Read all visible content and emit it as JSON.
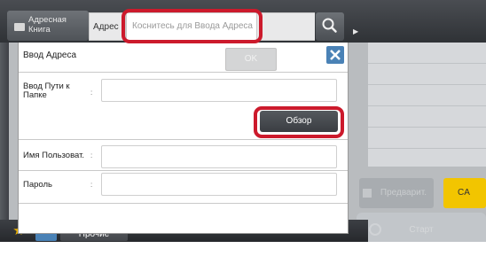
{
  "header": {
    "address_book_label": "Адресная Книга",
    "address_label": "Адрес",
    "address_placeholder": "Коснитесь для Ввода Адреса",
    "search_icon": "search-icon",
    "play_icon": "play-icon"
  },
  "dialog": {
    "title": "Ввод Адреса",
    "ok_label": "OK",
    "close_icon": "close-icon",
    "fields": [
      {
        "label": "Ввод Пути к Папке",
        "value": ""
      },
      {
        "label": "Имя Пользоват.",
        "value": ""
      },
      {
        "label": "Пароль",
        "value": ""
      }
    ],
    "colon": ":",
    "browse_label": "Обзор"
  },
  "right": {
    "preview_label": "Предварит.",
    "ca_label": "CA",
    "start_label": "Старт"
  },
  "footer": {
    "other_label": "Прочие"
  },
  "colors": {
    "highlight": "#cc1a2c",
    "accent_blue": "#4a82b6",
    "ca_yellow": "#f2c500",
    "star": "#f0b400"
  }
}
